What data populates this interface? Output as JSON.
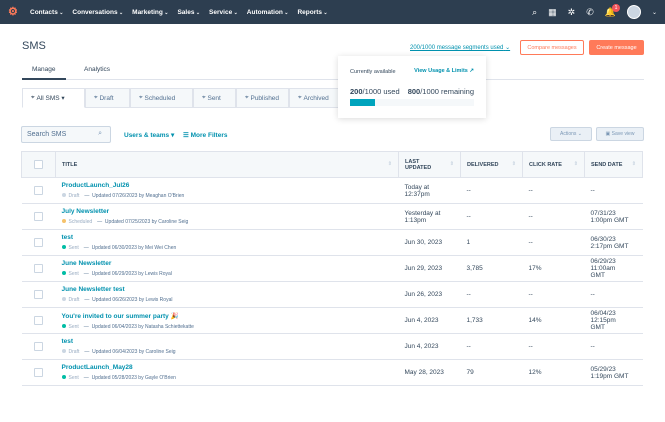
{
  "nav": {
    "items": [
      "Contacts",
      "Conversations",
      "Marketing",
      "Sales",
      "Service",
      "Automation",
      "Reports"
    ],
    "notification_count": "1"
  },
  "page": {
    "title": "SMS",
    "segments_used": "200/1000 message segments used",
    "compare_label": "Compare messages",
    "create_label": "Create message"
  },
  "tabs": [
    "Manage",
    "Analytics"
  ],
  "filter_tabs": [
    "All SMS",
    "Draft",
    "Scheduled",
    "Sent",
    "Published",
    "Archived"
  ],
  "popover": {
    "title": "Currently available",
    "link": "View Usage & Limits",
    "used": "200",
    "used_suffix": "/1000 used",
    "remaining": "800",
    "remaining_suffix": "/1000 remaining",
    "used_percent": 20
  },
  "toolbar": {
    "search_placeholder": "Search SMS",
    "users_teams": "Users & teams",
    "more_filters": "More Filters",
    "actions": "Actions",
    "save_view": "Save view"
  },
  "columns": [
    "TITLE",
    "LAST UPDATED",
    "DELIVERED",
    "CLICK RATE",
    "SEND DATE"
  ],
  "status_colors": {
    "Draft": "#cbd6e2",
    "Scheduled": "#f5c26b",
    "Sent": "#00bda5"
  },
  "rows": [
    {
      "title": "ProductLaunch_Jul26",
      "status": "Draft",
      "updated": "Updated 07/26/2023 by Meaghan O'Brien",
      "last_updated": "Today at 12:37pm",
      "delivered": "--",
      "click_rate": "--",
      "send_date": "--"
    },
    {
      "title": "July Newsletter",
      "status": "Scheduled",
      "updated": "Updated 07/25/2023 by Caroline Seig",
      "last_updated": "Yesterday at 1:13pm",
      "delivered": "--",
      "click_rate": "--",
      "send_date": "07/31/23 1:00pm GMT"
    },
    {
      "title": "test",
      "status": "Sent",
      "updated": "Updated 06/30/2023 by Mei Wei Chen",
      "last_updated": "Jun 30, 2023",
      "delivered": "1",
      "click_rate": "--",
      "send_date": "06/30/23 2:17pm GMT"
    },
    {
      "title": "June Newsletter",
      "status": "Sent",
      "updated": "Updated 06/29/2023 by Lewis Royal",
      "last_updated": "Jun 29, 2023",
      "delivered": "3,785",
      "click_rate": "17%",
      "send_date": "06/29/23 11:00am GMT"
    },
    {
      "title": "June Newsletter test",
      "status": "Draft",
      "updated": "Updated 06/26/2023 by Lewis Royal",
      "last_updated": "Jun 26, 2023",
      "delivered": "--",
      "click_rate": "--",
      "send_date": "--"
    },
    {
      "title": "You're invited to our summer party 🎉",
      "status": "Sent",
      "updated": "Updated 06/04/2023 by Natasha Schiettekatte",
      "last_updated": "Jun 4, 2023",
      "delivered": "1,733",
      "click_rate": "14%",
      "send_date": "06/04/23 12:15pm GMT"
    },
    {
      "title": "test",
      "status": "Draft",
      "updated": "Updated 06/04/2023 by Caroline Seig",
      "last_updated": "Jun 4, 2023",
      "delivered": "--",
      "click_rate": "--",
      "send_date": "--"
    },
    {
      "title": "ProductLaunch_May28",
      "status": "Sent",
      "updated": "Updated 05/28/2023 by Gayle O'Brien",
      "last_updated": "May 28, 2023",
      "delivered": "79",
      "click_rate": "12%",
      "send_date": "05/29/23 1:19pm GMT"
    }
  ]
}
